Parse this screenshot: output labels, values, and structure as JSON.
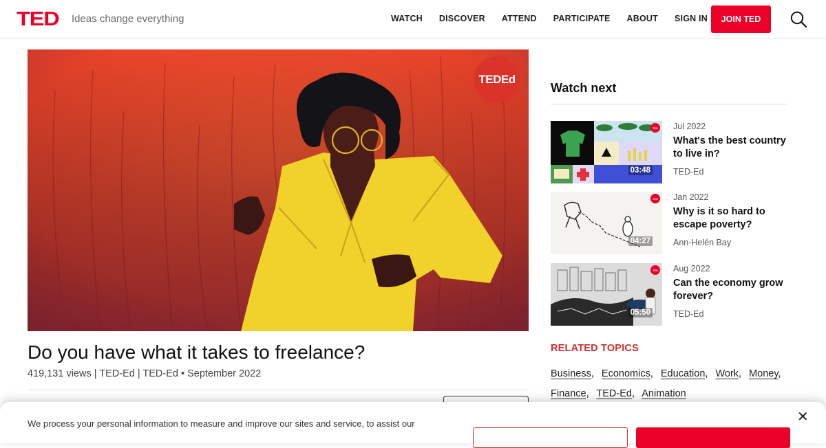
{
  "header": {
    "logo": "TED",
    "tagline": "Ideas change everything",
    "nav": [
      "WATCH",
      "DISCOVER",
      "ATTEND",
      "PARTICIPATE",
      "ABOUT",
      "SIGN IN"
    ],
    "join_label": "JOIN TED",
    "search_icon": "search-icon"
  },
  "hero": {
    "badge": "TEDEd"
  },
  "talk": {
    "title": "Do you have what it takes to freelance?",
    "meta": "419,131 views | TED-Ed | TED-Ed • September 2022"
  },
  "sidebar": {
    "watch_next_heading": "Watch next",
    "cards": [
      {
        "date": "Jul 2022",
        "title": "What's the best country to live in?",
        "speaker": "TED-Ed",
        "duration": "03:48"
      },
      {
        "date": "Jan 2022",
        "title": "Why is it so hard to escape poverty?",
        "speaker": "Ann-Helén Bay",
        "duration": "04:27"
      },
      {
        "date": "Aug 2022",
        "title": "Can the economy grow forever?",
        "speaker": "TED-Ed",
        "duration": "05:50"
      }
    ],
    "related_heading": "RELATED TOPICS",
    "topics": [
      "Business",
      "Economics",
      "Education",
      "Work",
      "Money",
      "Finance",
      "TED-Ed",
      "Animation"
    ]
  },
  "cookie": {
    "text": "We process your personal information to measure and improve our sites and service, to assist our",
    "close_icon": "close-icon"
  },
  "colors": {
    "brand_red": "#eb0028",
    "topic_heading": "#cf2e2e"
  }
}
